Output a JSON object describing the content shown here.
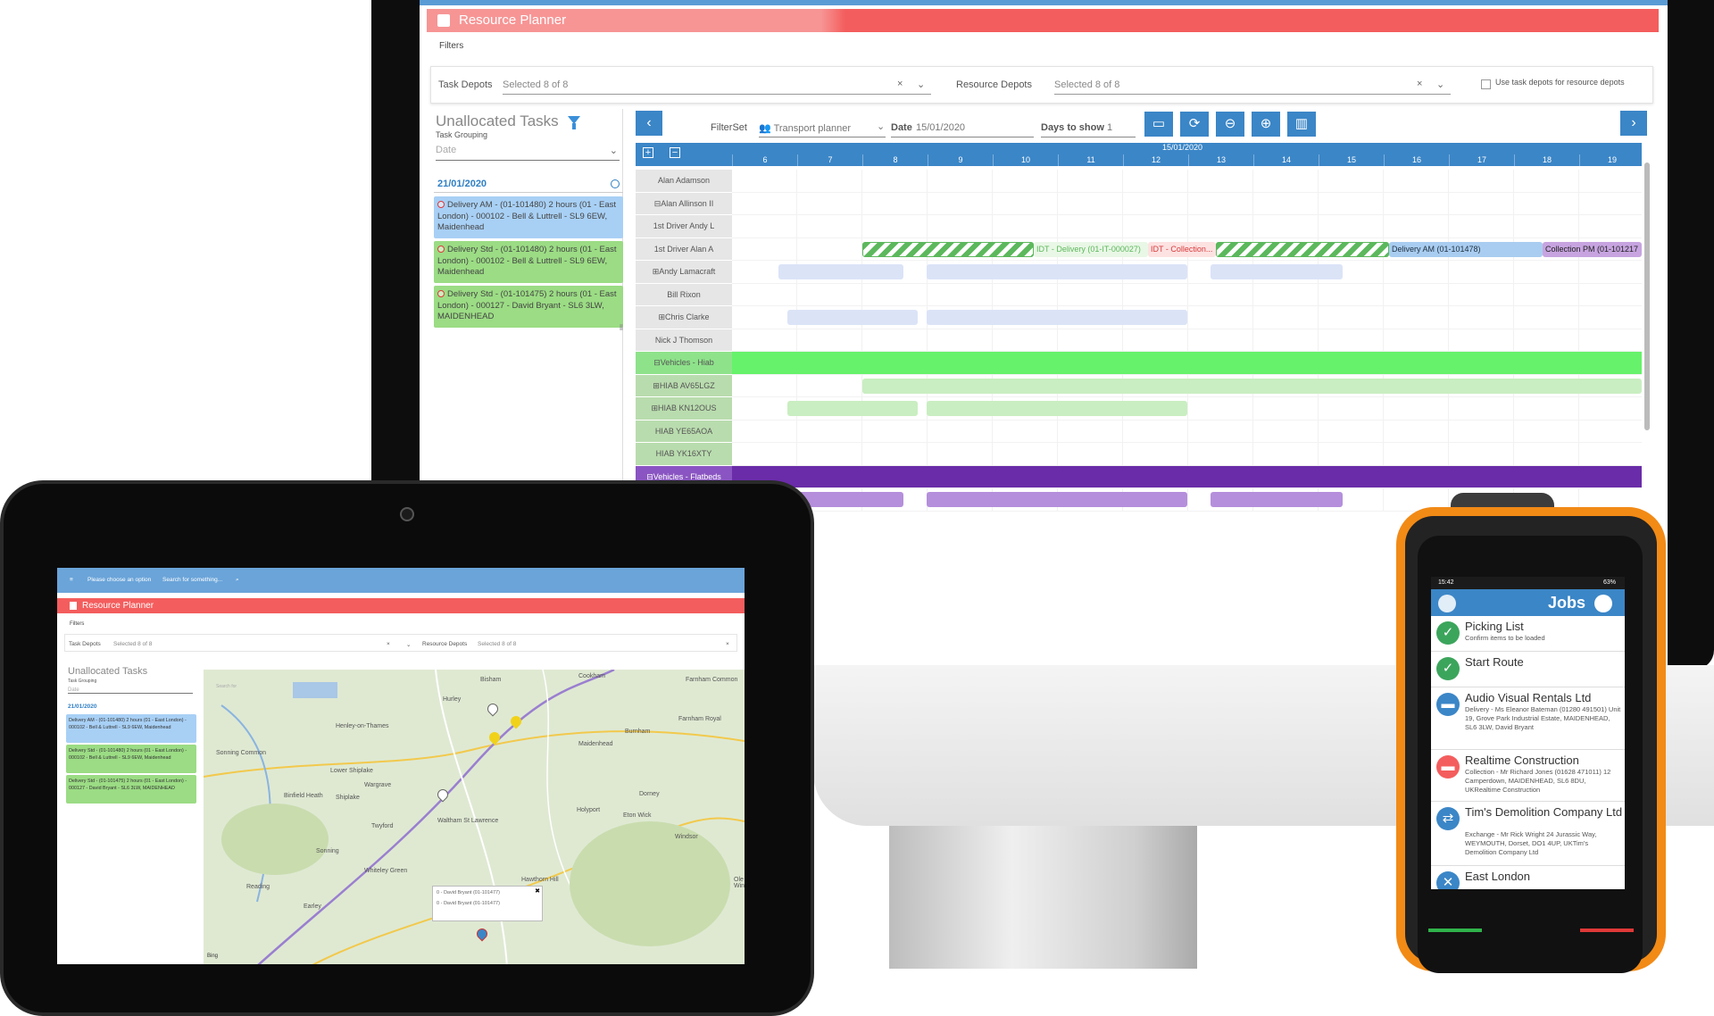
{
  "desktop": {
    "title": "Resource Planner",
    "filters_label": "Filters",
    "task_depots_label": "Task Depots",
    "task_depots_value": "Selected 8 of 8",
    "resource_depots_label": "Resource Depots",
    "resource_depots_value": "Selected 8 of 8",
    "clear_symbol": "×",
    "use_task_depots_label": "Use task depots for resource depots",
    "unallocated": {
      "title": "Unallocated Tasks",
      "grouping_label": "Task Grouping",
      "date_placeholder": "Date",
      "group_date": "21/01/2020",
      "tasks": [
        {
          "text": "Delivery AM - (01-101480) 2 hours (01 - East London) - 000102 - Bell & Luttrell - SL9 6EW, Maidenhead",
          "color": "#a8d0f5"
        },
        {
          "text": "Delivery Std - (01-101480) 2 hours (01 - East London) - 000102 - Bell & Luttrell - SL9 6EW, Maidenhead",
          "color": "#9bdc84"
        },
        {
          "text": "Delivery Std - (01-101475) 2 hours (01 - East London) - 000127 - David Bryant - SL6 3LW, MAIDENHEAD",
          "color": "#9bdc84"
        }
      ]
    },
    "toolbar": {
      "filterset_label": "FilterSet",
      "filterset_value": "Transport planner",
      "date_label": "Date",
      "date_value": "15/01/2020",
      "days_label": "Days to show",
      "days_value": "1"
    },
    "grid": {
      "header_date": "15/01/2020",
      "hours": [
        "6",
        "7",
        "8",
        "9",
        "10",
        "11",
        "12",
        "13",
        "14",
        "15",
        "16",
        "17",
        "18",
        "19"
      ],
      "rows": [
        {
          "name": "Alan Adamson"
        },
        {
          "name": "⊟Alan Allinson II"
        },
        {
          "name": "1st Driver Andy L"
        },
        {
          "name": "1st Driver Alan A"
        },
        {
          "name": "⊞Andy Lamacraft"
        },
        {
          "name": "Bill Rixon"
        },
        {
          "name": "⊞Chris Clarke"
        },
        {
          "name": "Nick J Thomson"
        },
        {
          "name": "⊟Vehicles - Hiab"
        },
        {
          "name": "⊞HIAB AV65LGZ"
        },
        {
          "name": "⊞HIAB KN12OUS"
        },
        {
          "name": "HIAB YE65AOA"
        },
        {
          "name": "HIAB YK16XTY"
        },
        {
          "name": "⊟Vehicles - Flatbeds"
        },
        {
          "name": ""
        }
      ],
      "bar_labels": {
        "idt_delivery": "IDT - Delivery (01-IT-000027)",
        "idt_collection": "IDT - Collection...",
        "delivery_am": "Delivery AM (01-101478)",
        "collection_pm": "Collection PM (01-101217"
      }
    },
    "colors": {
      "accent": "#3b86c7",
      "title_red": "#f45d5d",
      "hiab_green": "#66f26a",
      "flatbed_purple": "#6a2ca8"
    }
  },
  "tablet": {
    "search_option": "Please choose an option",
    "search_placeholder": "Search for something...",
    "title": "Resource Planner",
    "filters_label": "Filters",
    "task_depots_label": "Task Depots",
    "task_depots_value": "Selected 8 of 8",
    "resource_depots_label": "Resource Depots",
    "resource_depots_value": "Selected 8 of 8",
    "unallocated_title": "Unallocated Tasks",
    "grouping_label": "Task Grouping",
    "date_placeholder": "Date",
    "group_date": "21/01/2020",
    "tasks": [
      "Delivery AM - (01-101480) 2 hours (01 - East London) - 000102 - Bell & Luttrell - SL9 6EW, Maidenhead",
      "Delivery Std - (01-101480) 2 hours (01 - East London) - 000102 - Bell & Luttrell - SL9 6EW, Maidenhead",
      "Delivery Std - (01-101475) 2 hours (01 - East London) - 000127 - David Bryant - SL6 3LW, MAIDENHEAD"
    ],
    "map_places": [
      "Bisham",
      "Cookham",
      "Farnham Common",
      "Hurley",
      "Henley-on-Thames",
      "Burnham",
      "Farnham Royal",
      "Maidenhead",
      "Sonning Common",
      "Lower Shiplake",
      "Wargrave",
      "Binfield Heath",
      "Shiplake",
      "Dorney",
      "Holyport",
      "Eton Wick",
      "Waltham St Lawrence",
      "Twyford",
      "Windsor",
      "Sonning",
      "Whiteley Green",
      "Hawthorn Hill",
      "Reading",
      "Earley",
      "Binfield",
      "Ole Windsor"
    ],
    "map_popup": [
      "0 - David Bryant (01-101477)",
      "0 - David Bryant (01-101477)"
    ],
    "map_search_placeholder": "Search for",
    "map_credit": "Bing"
  },
  "phone": {
    "status_time": "15:42",
    "status_battery": "63%",
    "header": "Jobs",
    "items": [
      {
        "title": "Picking List",
        "sub": "Confirm items to be loaded",
        "color": "#3ca55c",
        "icon": "check-icon"
      },
      {
        "title": "Start Route",
        "sub": "",
        "color": "#3ca55c",
        "icon": "check-icon"
      },
      {
        "title": "Audio Visual Rentals Ltd",
        "sub": "Delivery - Ms Eleanor Bateman (01280 491501) Unit 19, Grove Park Industrial Estate, MAIDENHEAD, SL6 3LW, David Bryant",
        "color": "#3b86c7",
        "icon": "truck-icon"
      },
      {
        "title": "Realtime Construction",
        "sub": "Collection - Mr Richard Jones (01628 471011) 12 Camperdown, MAIDENHEAD, SL6 8DU, UKRealtime Construction",
        "color": "#f45d5d",
        "icon": "truck-icon"
      },
      {
        "title": "Tim's Demolition Company Ltd",
        "sub": "Exchange - Mr Rick Wright 24 Jurassic Way, WEYMOUTH, Dorset, DO1 4UP, UKTim's Demolition Company Ltd",
        "color": "#3b86c7",
        "icon": "exchange-icon"
      },
      {
        "title": "East London",
        "sub": "",
        "color": "#3b86c7",
        "icon": "depot-icon"
      }
    ]
  }
}
